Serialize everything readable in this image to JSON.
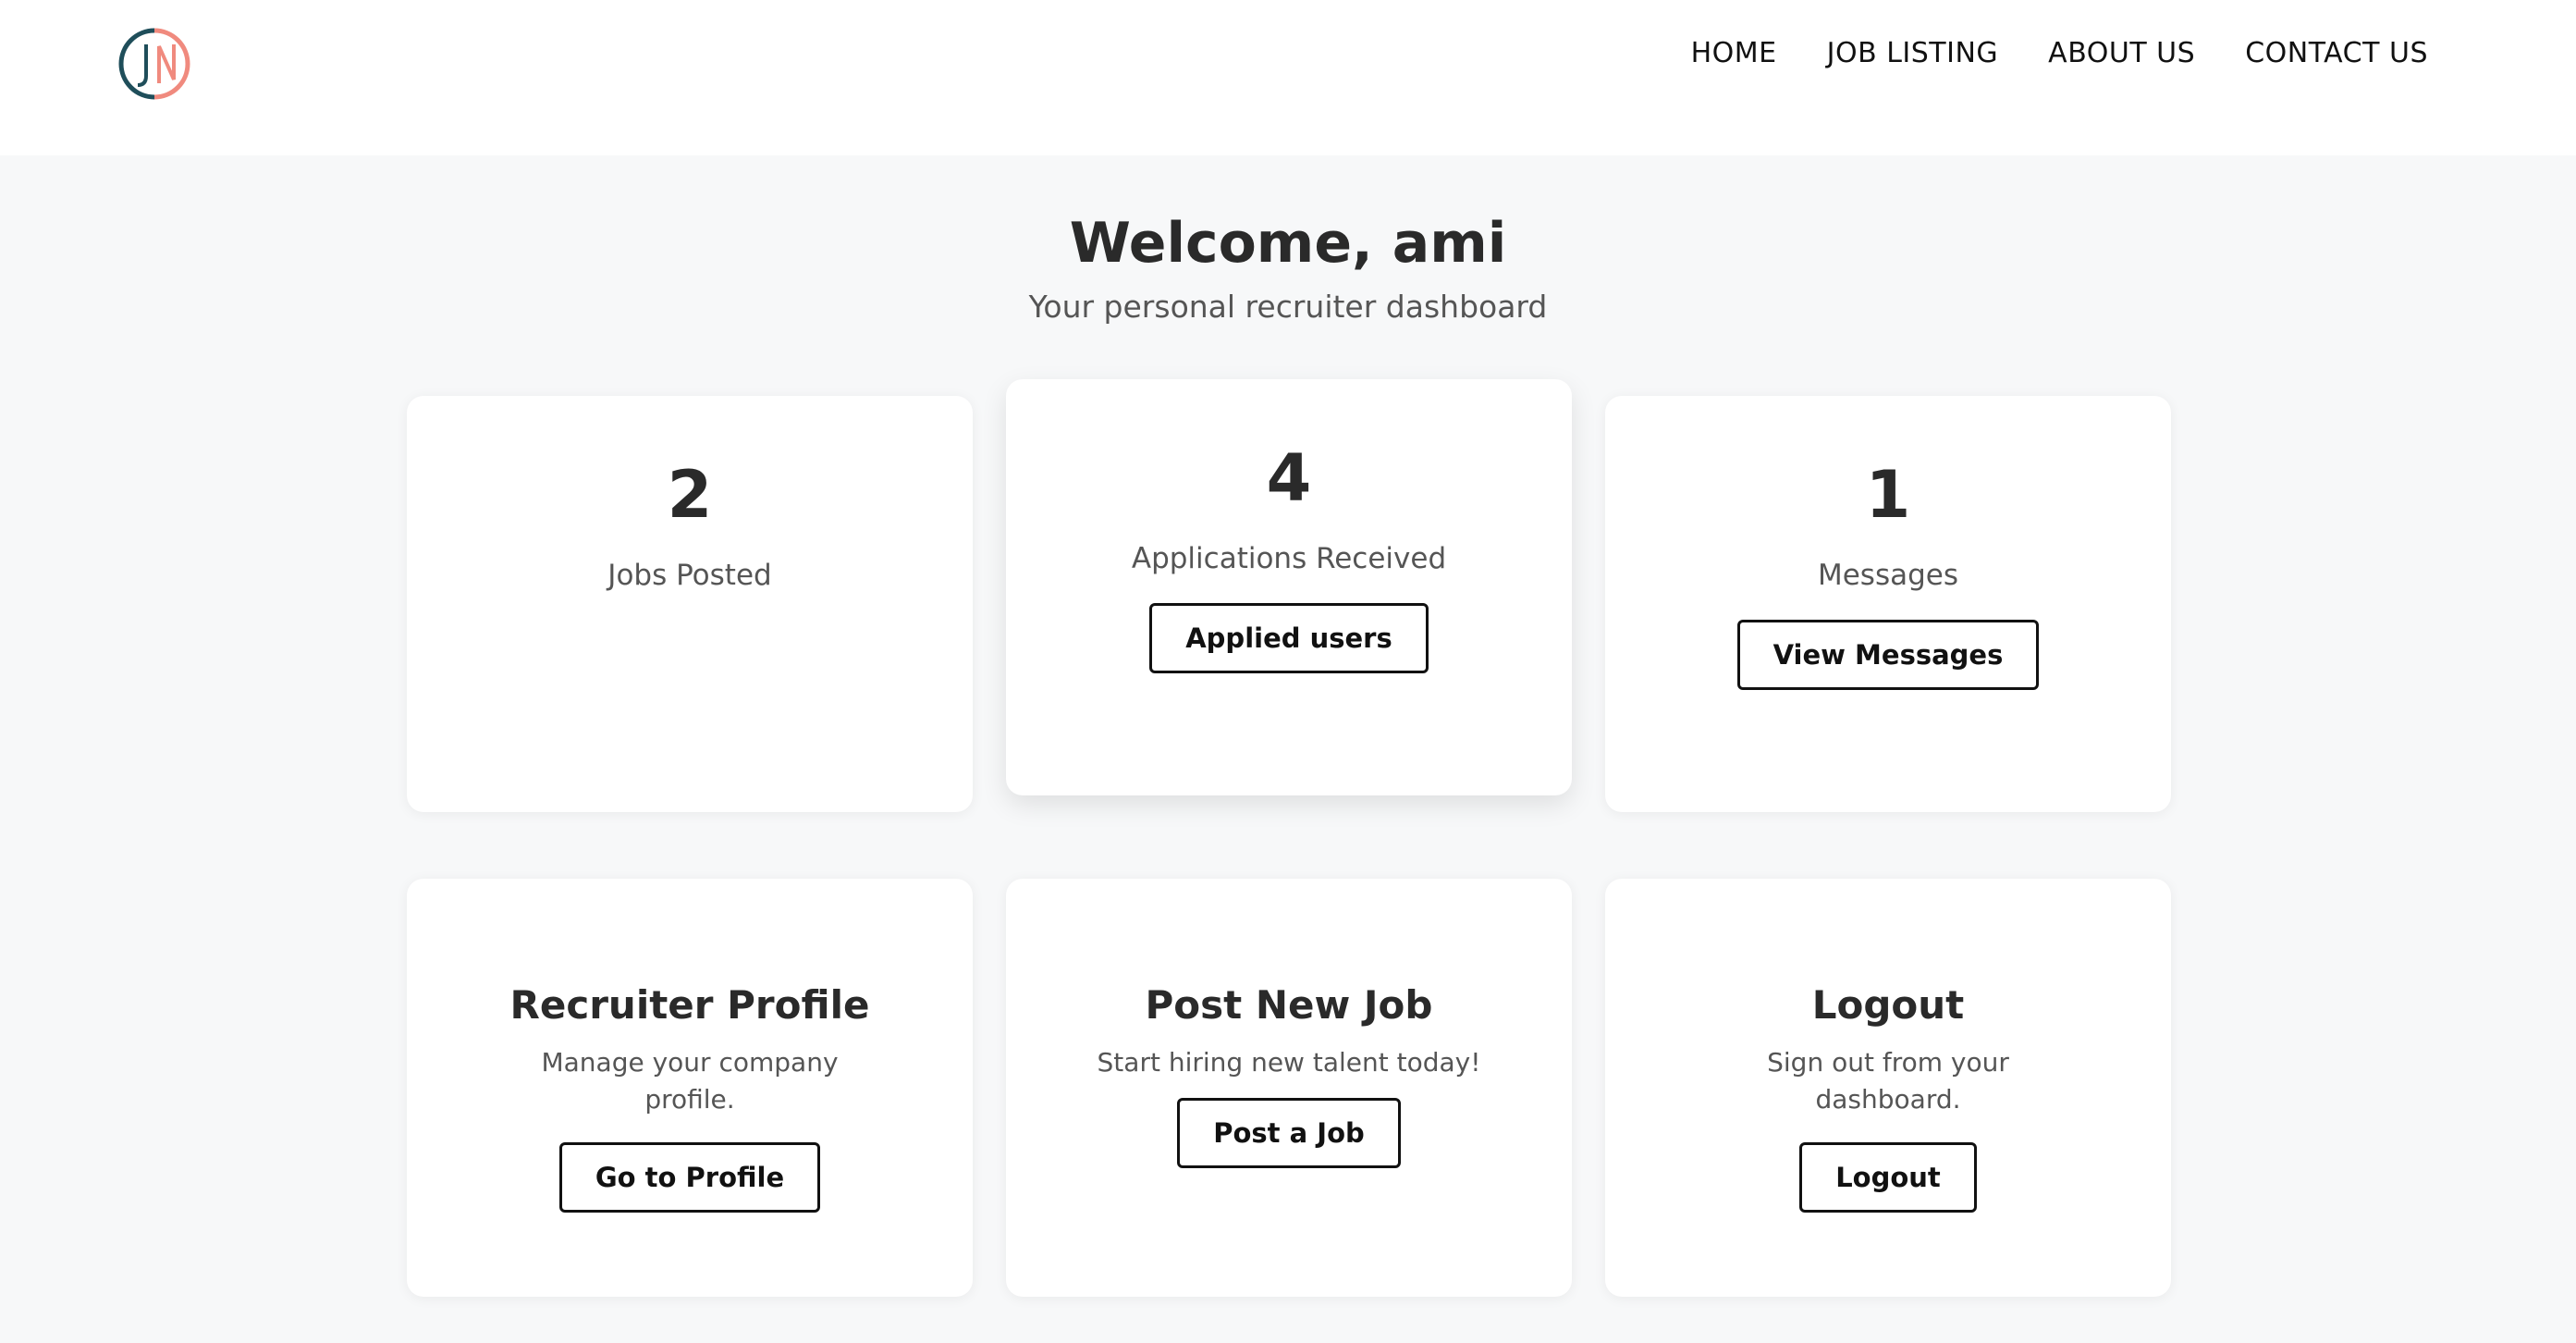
{
  "nav": {
    "links": [
      "HOME",
      "JOB LISTING",
      "ABOUT US",
      "CONTACT US"
    ]
  },
  "header": {
    "title": "Welcome, ami",
    "subtitle": "Your personal recruiter dashboard"
  },
  "stats": {
    "jobs_posted": {
      "value": "2",
      "label": "Jobs Posted"
    },
    "applications": {
      "value": "4",
      "label": "Applications Received",
      "button": "Applied users"
    },
    "messages": {
      "value": "1",
      "label": "Messages",
      "button": "View Messages"
    }
  },
  "actions": {
    "profile": {
      "title": "Recruiter Profile",
      "desc": "Manage your company profile.",
      "button": "Go to Profile"
    },
    "post_job": {
      "title": "Post New Job",
      "desc": "Start hiring new talent today!",
      "button": "Post a Job"
    },
    "logout": {
      "title": "Logout",
      "desc": "Sign out from your dashboard.",
      "button": "Logout"
    }
  },
  "colors": {
    "logo_teal": "#1f4e5a",
    "logo_coral": "#f08a7e",
    "background": "#f7f8f9"
  }
}
